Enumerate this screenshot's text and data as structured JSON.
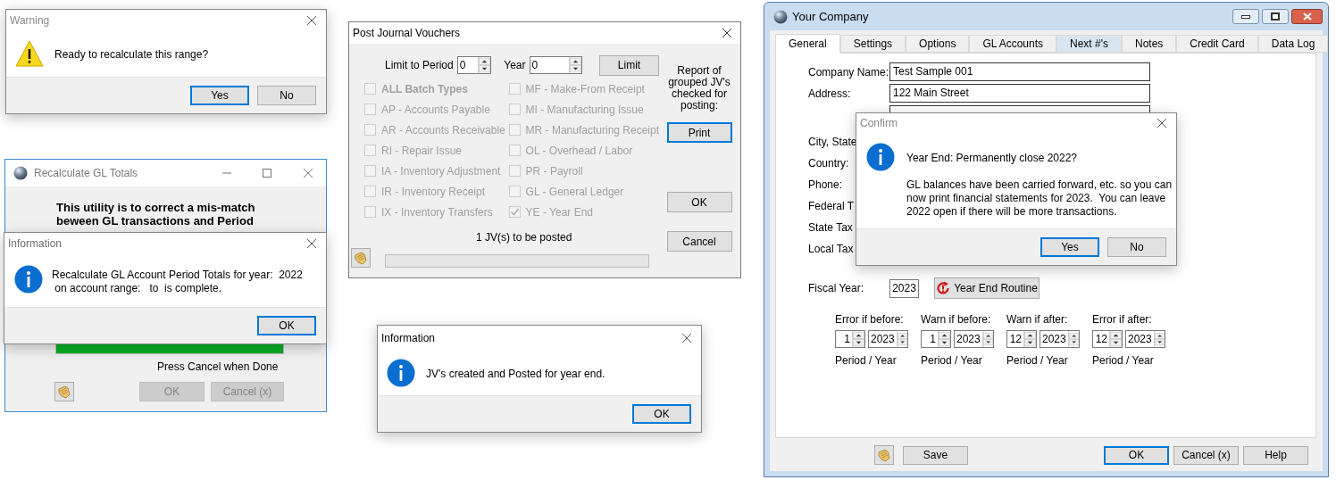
{
  "warning": {
    "title": "Warning",
    "message": "Ready to recalculate this range?",
    "buttons": [
      {
        "label": "Yes",
        "default": true
      },
      {
        "label": "No",
        "default": false
      }
    ]
  },
  "recalculate": {
    "title": "Recalculate GL Totals",
    "intro": "This utility is to correct a mis-match\nbeween GL transactions and Period",
    "progress": {
      "level": 1
    },
    "status": "Press Cancel when Done",
    "buttons": [
      {
        "label": "OK",
        "disabled": true
      },
      {
        "label": "Cancel (x)",
        "disabled": true
      }
    ]
  },
  "recalculate_info": {
    "title": "Information",
    "message": "Recalculate GL Account Period Totals for year:  2022\n on account range:   to  is complete.",
    "buttons": [
      {
        "label": "OK",
        "default": true
      }
    ]
  },
  "post_journal_vouchers": {
    "title": "Post Journal Vouchers",
    "period_label": "Limit to Period",
    "period": "0",
    "year_label": "Year",
    "year": "0",
    "limit_button": "Limit",
    "left_column": [
      {
        "label": "ALL Batch Types",
        "kind": "all",
        "checked": false,
        "disabled": true
      },
      {
        "label": "AP - Accounts Payable",
        "kind": "batch",
        "checked": false,
        "disabled": true
      },
      {
        "label": "AR - Accounts Receivable",
        "kind": "batch",
        "checked": false,
        "disabled": true
      },
      {
        "label": "RI - Repair Issue",
        "kind": "batch",
        "checked": false,
        "disabled": true
      },
      {
        "label": "IA - Inventory Adjustment",
        "kind": "batch",
        "checked": false,
        "disabled": true
      },
      {
        "label": "IR - Inventory Receipt",
        "kind": "batch",
        "checked": false,
        "disabled": true
      },
      {
        "label": "IX - Inventory Transfers",
        "kind": "batch",
        "checked": false,
        "disabled": true
      }
    ],
    "right_column": [
      {
        "label": "MF - Make-From Receipt",
        "kind": "batch",
        "checked": false,
        "disabled": true
      },
      {
        "label": "MI - Manufacturing Issue",
        "kind": "batch",
        "checked": false,
        "disabled": true
      },
      {
        "label": "MR - Manufacturing Receipt",
        "kind": "batch",
        "checked": false,
        "disabled": true
      },
      {
        "label": "OL - Overhead / Labor",
        "kind": "batch",
        "checked": false,
        "disabled": true
      },
      {
        "label": "PR - Payroll",
        "kind": "batch",
        "checked": false,
        "disabled": true
      },
      {
        "label": "GL - General Ledger",
        "kind": "batch",
        "checked": false,
        "disabled": true
      },
      {
        "label": "YE - Year End",
        "kind": "batch",
        "checked": true,
        "disabled": true
      }
    ],
    "report_note": "Report of grouped JV's checked for posting:",
    "print_button": {
      "label": "Print",
      "default": true
    },
    "ok_button": "OK",
    "cancel_button": "Cancel",
    "count": "1 JV(s) to be posted",
    "progress": {
      "level": 0
    }
  },
  "jv_info": {
    "title": "Information",
    "message": "JV's created and Posted for year end.",
    "buttons": [
      {
        "label": "OK",
        "default": true
      }
    ]
  },
  "company": {
    "title": "Your Company",
    "tabs": [
      {
        "label": "General",
        "selected": true,
        "hovered": false
      },
      {
        "label": "Settings",
        "selected": false,
        "hovered": false
      },
      {
        "label": "Options",
        "selected": false,
        "hovered": false
      },
      {
        "label": "GL Accounts",
        "selected": false,
        "hovered": false
      },
      {
        "label": "Next #'s",
        "selected": false,
        "hovered": true
      },
      {
        "label": "Notes",
        "selected": false,
        "hovered": false
      },
      {
        "label": "Credit Card",
        "selected": false,
        "hovered": false
      },
      {
        "label": "Data Log",
        "selected": false,
        "hovered": false
      }
    ],
    "fields": [
      {
        "kind": "field",
        "label": "Company Name:",
        "value": "Test Sample 001"
      },
      {
        "kind": "field",
        "label": "Address:",
        "value": "122 Main Street"
      },
      {
        "kind": "field"
      }
    ],
    "labels": [
      "City, State",
      "Country:",
      "Phone:",
      "Federal T",
      "State Tax",
      "Local Tax"
    ],
    "fiscal_year_label": "Fiscal Year:",
    "fiscal_year": "2023",
    "year_end_button": "Year End Routine",
    "limits": [
      {
        "label": "Error if before:",
        "period": "1",
        "year": "2023",
        "caption": "Period / Year"
      },
      {
        "label": "Warn if before:",
        "period": "1",
        "year": "2023",
        "caption": "Period / Year"
      },
      {
        "label": "Warn if after:",
        "period": "12",
        "year": "2023",
        "caption": "Period / Year"
      },
      {
        "label": "Error if after:",
        "period": "12",
        "year": "2023",
        "caption": "Period / Year"
      }
    ],
    "buttons": [
      {
        "label": "Save",
        "default": false
      },
      {
        "label": "OK",
        "default": true
      },
      {
        "label": "Cancel (x)",
        "default": false
      },
      {
        "label": "Help",
        "default": false
      }
    ]
  },
  "confirm": {
    "title": "Confirm",
    "question": "Year End: Permanently close 2022?",
    "detail": "GL balances have been carried forward, etc. so you can\nnow print financial statements for 2023.  You can leave\n2022 open if there will be more transactions.",
    "buttons": [
      {
        "label": "Yes",
        "default": true
      },
      {
        "label": "No",
        "default": false
      }
    ]
  }
}
